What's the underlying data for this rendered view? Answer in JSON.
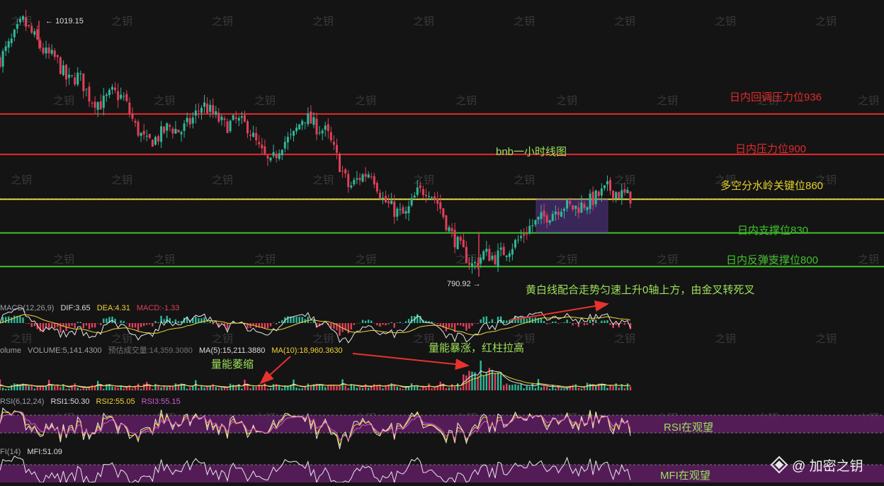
{
  "colors": {
    "background": "#141414",
    "up": "#2fb89a",
    "down": "#e0405a",
    "resistance": "#e3292c",
    "key_level": "#e3d22a",
    "support": "#3fc12a",
    "annotation_green": "#9ee05a",
    "annotation_yellow": "#f0d43a",
    "arrow": "#e8322e",
    "box": "#6a3fb0",
    "rsi_band": "#5a1d5e",
    "watermark": "#3a3a3a",
    "text_muted": "#9aa0a6",
    "text_white": "#dddddd"
  },
  "watermark_text": "之钥",
  "logo": {
    "text": "@ 加密之钥",
    "icon": "diamond-logo-icon"
  },
  "chart_data": [
    {
      "type": "candlestick",
      "title": "bnb一小时线图",
      "ylim": [
        785,
        1025
      ],
      "max_label": "1019.15",
      "min_label": "790.92",
      "max_value": 1019.15,
      "min_value": 790.92,
      "levels": [
        {
          "label": "日内回调压力位936",
          "value": 936,
          "color": "#e3292c"
        },
        {
          "label": "日内压力位900",
          "value": 900,
          "color": "#e3292c"
        },
        {
          "label": "多空分水岭关键位860",
          "value": 860,
          "color": "#e3d22a"
        },
        {
          "label": "日内支撑位830",
          "value": 830,
          "color": "#3fc12a"
        },
        {
          "label": "日内反弹支撑位800",
          "value": 800,
          "color": "#3fc12a"
        }
      ],
      "consolidation_box": {
        "from": 0.61,
        "to": 0.69,
        "low": 830,
        "high": 860
      },
      "price_path": [
        [
          0.0,
          985
        ],
        [
          0.02,
          1000
        ],
        [
          0.04,
          1019
        ],
        [
          0.06,
          1005
        ],
        [
          0.08,
          990
        ],
        [
          0.1,
          985
        ],
        [
          0.12,
          965
        ],
        [
          0.14,
          970
        ],
        [
          0.16,
          950
        ],
        [
          0.18,
          945
        ],
        [
          0.2,
          955
        ],
        [
          0.22,
          950
        ],
        [
          0.24,
          925
        ],
        [
          0.26,
          910
        ],
        [
          0.28,
          915
        ],
        [
          0.3,
          925
        ],
        [
          0.32,
          920
        ],
        [
          0.34,
          930
        ],
        [
          0.36,
          945
        ],
        [
          0.38,
          935
        ],
        [
          0.4,
          925
        ],
        [
          0.42,
          930
        ],
        [
          0.44,
          925
        ],
        [
          0.46,
          905
        ],
        [
          0.48,
          890
        ],
        [
          0.5,
          910
        ],
        [
          0.52,
          915
        ],
        [
          0.54,
          935
        ],
        [
          0.56,
          925
        ],
        [
          0.58,
          920
        ],
        [
          0.6,
          895
        ],
        [
          0.62,
          870
        ],
        [
          0.64,
          880
        ],
        [
          0.66,
          885
        ],
        [
          0.68,
          860
        ],
        [
          0.7,
          850
        ],
        [
          0.72,
          845
        ],
        [
          0.74,
          865
        ],
        [
          0.76,
          870
        ],
        [
          0.78,
          855
        ],
        [
          0.8,
          830
        ],
        [
          0.82,
          815
        ],
        [
          0.84,
          800
        ],
        [
          0.86,
          812
        ],
        [
          0.88,
          808
        ],
        [
          0.9,
          815
        ],
        [
          0.92,
          823
        ],
        [
          0.94,
          835
        ],
        [
          0.96,
          842
        ],
        [
          0.98,
          848
        ],
        [
          1.0,
          855
        ],
        [
          1.02,
          852
        ],
        [
          1.04,
          856
        ],
        [
          1.06,
          862
        ],
        [
          1.08,
          870
        ],
        [
          1.1,
          865
        ],
        [
          1.12,
          862
        ]
      ]
    },
    {
      "type": "macd",
      "legend": {
        "name": "MACD(12,26,9)",
        "dif": "DIF:3.65",
        "dea": "DEA:4.31",
        "macd": "MACD:-1.33"
      },
      "annotation": "黄白线配合走势匀速上升0轴上方，由金叉转死叉"
    },
    {
      "type": "volume",
      "legend": {
        "name": "olume",
        "volume": "VOLUME:5,141.4300",
        "estimate": "预估成交量:14,359.3080",
        "ma5": "MA(5):15,211.3880",
        "ma10": "MA(10):18,960.3630"
      },
      "annotations": [
        "量能萎缩",
        "量能暴涨，红柱拉高"
      ]
    },
    {
      "type": "rsi",
      "legend": {
        "name": "RSI(6,12,24)",
        "rsi1": "RSI1:50.30",
        "rsi2": "RSI2:55.05",
        "rsi3": "RSI3:55.15"
      },
      "annotation": "RSI在观望"
    },
    {
      "type": "mfi",
      "legend": {
        "name": "FI(14)",
        "mfi": "MFI:51.09"
      },
      "annotation": "MFI在观望"
    }
  ]
}
